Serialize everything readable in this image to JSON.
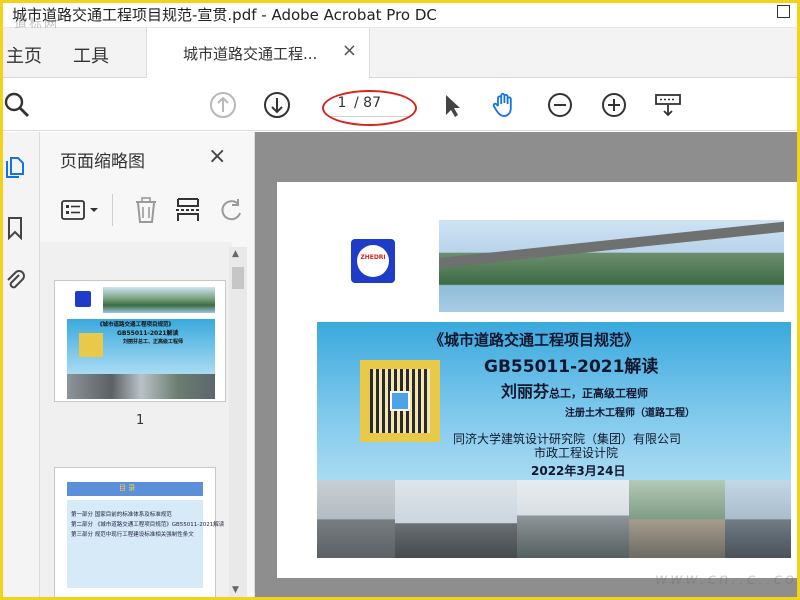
{
  "window": {
    "title": "城市道路交通工程项目规范-宣贯.pdf - Adobe Acrobat Pro DC",
    "watermark": "道标网"
  },
  "tabs": {
    "home": "主页",
    "tools": "工具",
    "document": "城市道路交通工程...",
    "close_glyph": "×"
  },
  "toolbar": {
    "current_page": "1",
    "total_pages": "/ 87",
    "icons": [
      "search-icon",
      "previous-page-icon",
      "next-page-icon",
      "select-tool-icon",
      "hand-tool-icon",
      "zoom-out-icon",
      "zoom-in-icon",
      "page-display-icon"
    ],
    "highlight_color": "#d8231e",
    "accent_color": "#1473e6"
  },
  "thumbnails_panel": {
    "title": "页面缩略图",
    "close_glyph": "×",
    "thumbnails": [
      {
        "page_label": "1",
        "title_lines": [
          "《城市道路交通工程项目规范》",
          "GB55011-2021解读",
          "刘丽芬总工、正高级工程师"
        ]
      },
      {
        "page_label": "",
        "header": "目 录",
        "lines": [
          "第一部分 国家目前的标准体系及标准规范",
          "第二部分 《城市道路交通工程项目规范》GB55011-2021解读",
          "第三部分 规范中现行工程建设标准相关强制性条文"
        ]
      }
    ]
  },
  "document": {
    "logo_text": "ZHEDRI",
    "banner": {
      "title": "《城市道路交通工程项目规范》",
      "subtitle": "GB55011-2021解读",
      "author_name": "刘丽芬",
      "author_role": "总工，正高级工程师",
      "author_cert": "注册土木工程师（道路工程）",
      "org_line1": "同济大学建筑设计研究院（集团）有限公司",
      "org_line2": "市政工程设计院",
      "date": "2022年3月24日"
    },
    "bottom_watermark": "www.cn..c..com"
  }
}
